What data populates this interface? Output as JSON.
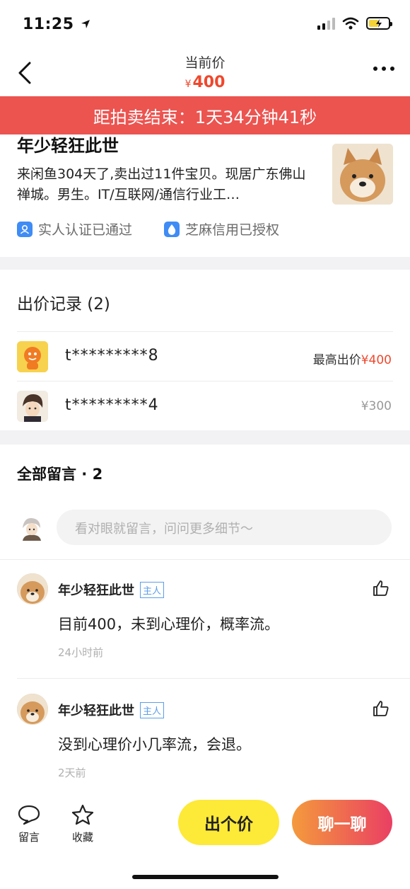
{
  "status_bar": {
    "time": "11:25"
  },
  "nav": {
    "title": "当前价",
    "currency": "¥",
    "price": "400"
  },
  "countdown": {
    "text": "距拍卖结束：1天34分钟41秒"
  },
  "seller": {
    "name": "年少轻狂此世",
    "bio": "来闲鱼304天了,卖出过11件宝贝。现居广东佛山禅城。男生。IT/互联网/通信行业工…",
    "cert_real": "实人认证已通过",
    "cert_credit": "芝麻信用已授权"
  },
  "bids": {
    "title": "出价记录 (2)",
    "items": [
      {
        "user": "t*********8",
        "label": "最高出价",
        "price": "¥400"
      },
      {
        "user": "t*********4",
        "label": "",
        "price": "¥300"
      }
    ]
  },
  "comments": {
    "title": "全部留言 · 2",
    "placeholder": "看对眼就留言，问问更多细节～",
    "items": [
      {
        "name": "年少轻狂此世",
        "tag": "主人",
        "text": "目前400，未到心理价，概率流。",
        "time": "24小时前"
      },
      {
        "name": "年少轻狂此世",
        "tag": "主人",
        "text": "没到心理价小几率流，会退。",
        "time": "2天前"
      }
    ]
  },
  "bottom": {
    "comment": "留言",
    "favorite": "收藏",
    "bid": "出个价",
    "chat": "聊一聊"
  },
  "colors": {
    "accent_red": "#f0472c",
    "banner": "#ec5450",
    "bid_button": "#fde937",
    "chat_gradient": [
      "#f49a3c",
      "#ea3f63"
    ]
  }
}
